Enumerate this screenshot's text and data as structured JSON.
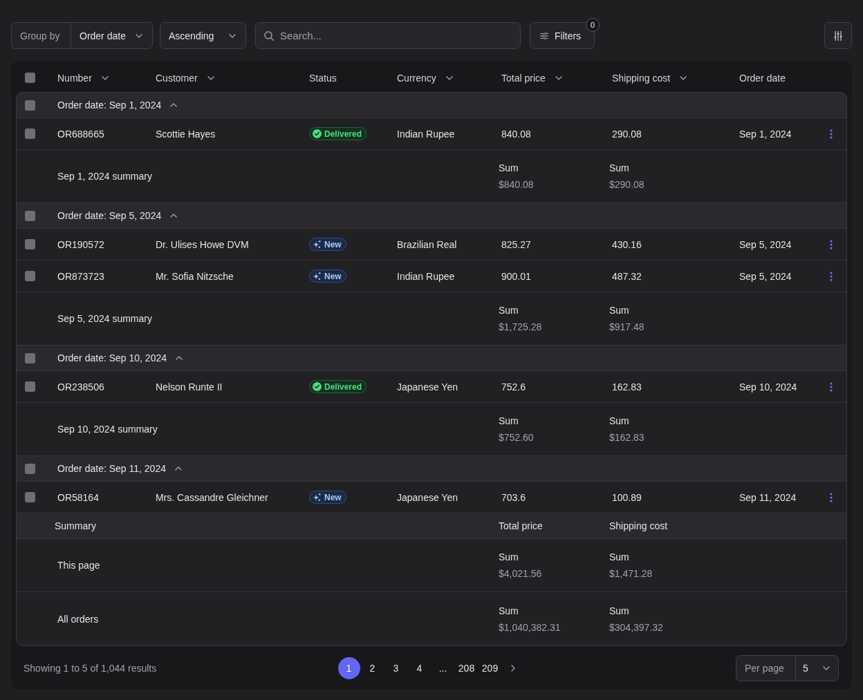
{
  "toolbar": {
    "group_by": {
      "label": "Group by",
      "value": "Order date"
    },
    "sort": {
      "value": "Ascending"
    },
    "search": {
      "placeholder": "Search..."
    },
    "filters": {
      "label": "Filters",
      "count": "0"
    }
  },
  "table": {
    "select_all": {
      "checked": false
    },
    "columns": [
      {
        "label": "Number",
        "sortable": true
      },
      {
        "label": "Customer",
        "sortable": true
      },
      {
        "label": "Status",
        "sortable": false
      },
      {
        "label": "Currency",
        "sortable": true
      },
      {
        "label": "Total price",
        "sortable": true
      },
      {
        "label": "Shipping cost",
        "sortable": true
      },
      {
        "label": "Order date",
        "sortable": false
      }
    ],
    "groups": [
      {
        "title": "Order date: Sep 1, 2024",
        "checked": false,
        "expanded": true,
        "rows": [
          {
            "checked": false,
            "number": "OR688665",
            "customer": "Scottie Hayes",
            "status": {
              "kind": "delivered",
              "label": "Delivered"
            },
            "currency": "Indian Rupee",
            "total_price": "840.08",
            "shipping_cost": "290.08",
            "order_date": "Sep 1, 2024"
          }
        ],
        "summary": {
          "label": "Sep 1, 2024 summary",
          "total_price": {
            "label": "Sum",
            "value": "$840.08"
          },
          "shipping_cost": {
            "label": "Sum",
            "value": "$290.08"
          }
        }
      },
      {
        "title": "Order date: Sep 5, 2024",
        "checked": false,
        "expanded": true,
        "rows": [
          {
            "checked": false,
            "number": "OR190572",
            "customer": "Dr. Ulises Howe DVM",
            "status": {
              "kind": "new",
              "label": "New"
            },
            "currency": "Brazilian Real",
            "total_price": "825.27",
            "shipping_cost": "430.16",
            "order_date": "Sep 5, 2024"
          },
          {
            "checked": false,
            "number": "OR873723",
            "customer": "Mr. Sofia Nitzsche",
            "status": {
              "kind": "new",
              "label": "New"
            },
            "currency": "Indian Rupee",
            "total_price": "900.01",
            "shipping_cost": "487.32",
            "order_date": "Sep 5, 2024"
          }
        ],
        "summary": {
          "label": "Sep 5, 2024 summary",
          "total_price": {
            "label": "Sum",
            "value": "$1,725.28"
          },
          "shipping_cost": {
            "label": "Sum",
            "value": "$917.48"
          }
        }
      },
      {
        "title": "Order date: Sep 10, 2024",
        "checked": false,
        "expanded": true,
        "rows": [
          {
            "checked": false,
            "number": "OR238506",
            "customer": "Nelson Runte II",
            "status": {
              "kind": "delivered",
              "label": "Delivered"
            },
            "currency": "Japanese Yen",
            "total_price": "752.6",
            "shipping_cost": "162.83",
            "order_date": "Sep 10, 2024"
          }
        ],
        "summary": {
          "label": "Sep 10, 2024 summary",
          "total_price": {
            "label": "Sum",
            "value": "$752.60"
          },
          "shipping_cost": {
            "label": "Sum",
            "value": "$162.83"
          }
        }
      },
      {
        "title": "Order date: Sep 11, 2024",
        "checked": false,
        "expanded": true,
        "rows": [
          {
            "checked": false,
            "number": "OR58164",
            "customer": "Mrs. Cassandre Gleichner",
            "status": {
              "kind": "new",
              "label": "New"
            },
            "currency": "Japanese Yen",
            "total_price": "703.6",
            "shipping_cost": "100.89",
            "order_date": "Sep 11, 2024"
          }
        ]
      }
    ],
    "summary": {
      "title": "Summary",
      "columns": [
        "Total price",
        "Shipping cost"
      ],
      "rows": [
        {
          "label": "This page",
          "total_price": {
            "label": "Sum",
            "value": "$4,021.56"
          },
          "shipping_cost": {
            "label": "Sum",
            "value": "$1,471.28"
          }
        },
        {
          "label": "All orders",
          "total_price": {
            "label": "Sum",
            "value": "$1,040,382.31"
          },
          "shipping_cost": {
            "label": "Sum",
            "value": "$304,397.32"
          }
        }
      ]
    }
  },
  "footer": {
    "results": "Showing 1 to 5 of 1,044 results",
    "pages": [
      {
        "kind": "page",
        "label": "1",
        "selected": true
      },
      {
        "kind": "page",
        "label": "2",
        "selected": false
      },
      {
        "kind": "page",
        "label": "3",
        "selected": false
      },
      {
        "kind": "page",
        "label": "4",
        "selected": false
      },
      {
        "kind": "ellipsis",
        "label": "..."
      },
      {
        "kind": "page",
        "label": "208",
        "selected": false
      },
      {
        "kind": "page",
        "label": "209",
        "selected": false
      }
    ],
    "per_page": {
      "label": "Per page",
      "value": "5"
    }
  }
}
